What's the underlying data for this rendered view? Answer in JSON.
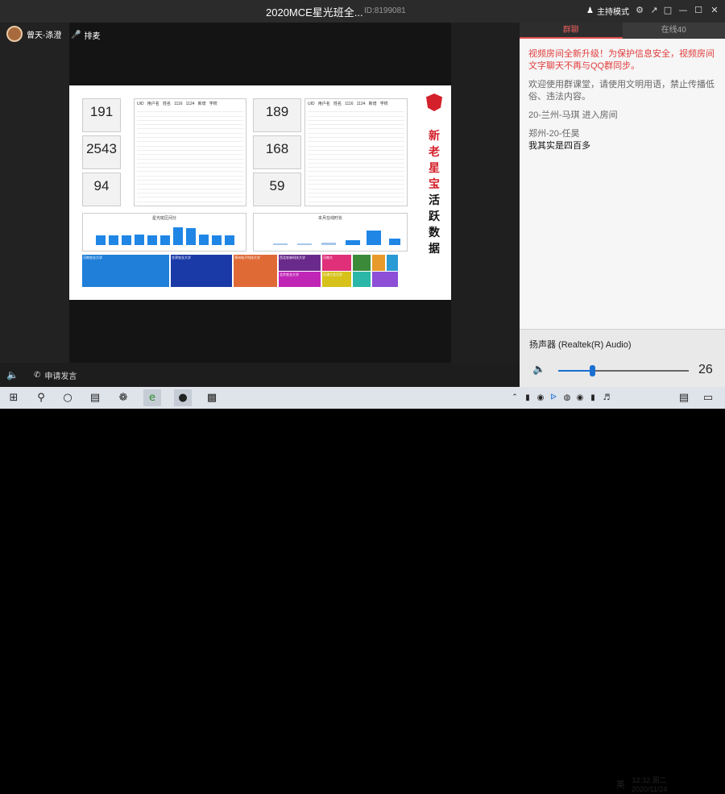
{
  "window": {
    "title": "2020MCE星光班全...",
    "room_id": "ID:8199081",
    "host_mode": "主持模式"
  },
  "left": {
    "user_name": "曾天-涤澄",
    "mic_label": "排麦"
  },
  "bottom": {
    "speak_label": "申请发言"
  },
  "slide": {
    "stats": [
      {
        "value": "191"
      },
      {
        "value": "2543"
      },
      {
        "value": "94"
      }
    ],
    "stats2": [
      {
        "value": "189"
      },
      {
        "value": "168"
      },
      {
        "value": "59"
      }
    ],
    "brand_chars": [
      "新",
      "老",
      "星",
      "宝",
      "活",
      "跃",
      "数",
      "据"
    ],
    "chart1_title": "星光班区间分",
    "chart2_title": "本月在线时长",
    "treemap": [
      {
        "label": "河南农业大学",
        "color": "#1f7fd9"
      },
      {
        "label": "甘肃农业大学",
        "color": "#1a3aa8"
      },
      {
        "label": "郑州电子科技大学",
        "color": "#e06a36"
      },
      {
        "label": "西北农林科技大学",
        "color": "#6a2a8c"
      },
      {
        "label": "北京农业大学",
        "color": "#c026b6"
      },
      {
        "label": "河南大",
        "color": "#e0307a"
      },
      {
        "label": "",
        "color": "#3a8a3a"
      },
      {
        "label": "",
        "color": "#e89a2a"
      },
      {
        "label": "",
        "color": "#2a9ad4"
      },
      {
        "label": "天津工业大学",
        "color": "#d6c21a"
      },
      {
        "label": "",
        "color": "#2ab7a8"
      },
      {
        "label": "",
        "color": "#8c4fd6"
      }
    ]
  },
  "panel": {
    "tabs": [
      {
        "label": "群聊"
      },
      {
        "label": "在线40"
      }
    ],
    "messages": [
      {
        "text": "视频房间全新升级！为保护信息安全，视频房间文字聊天不再与QQ群同步。"
      },
      {
        "text": "欢迎使用群课堂，请使用文明用语，禁止传播低俗、违法内容。"
      },
      {
        "text": "20-兰州-马琪 进入房间"
      },
      {
        "text": "郑州-20-任昊"
      },
      {
        "text": "我其实是四百多"
      }
    ]
  },
  "audio": {
    "device": "扬声器 (Realtek(R) Audio)",
    "volume": "26",
    "level": 0.26
  },
  "taskbar": {
    "time": "12:32 周二",
    "date": "2020/11/24",
    "ime": "英"
  }
}
